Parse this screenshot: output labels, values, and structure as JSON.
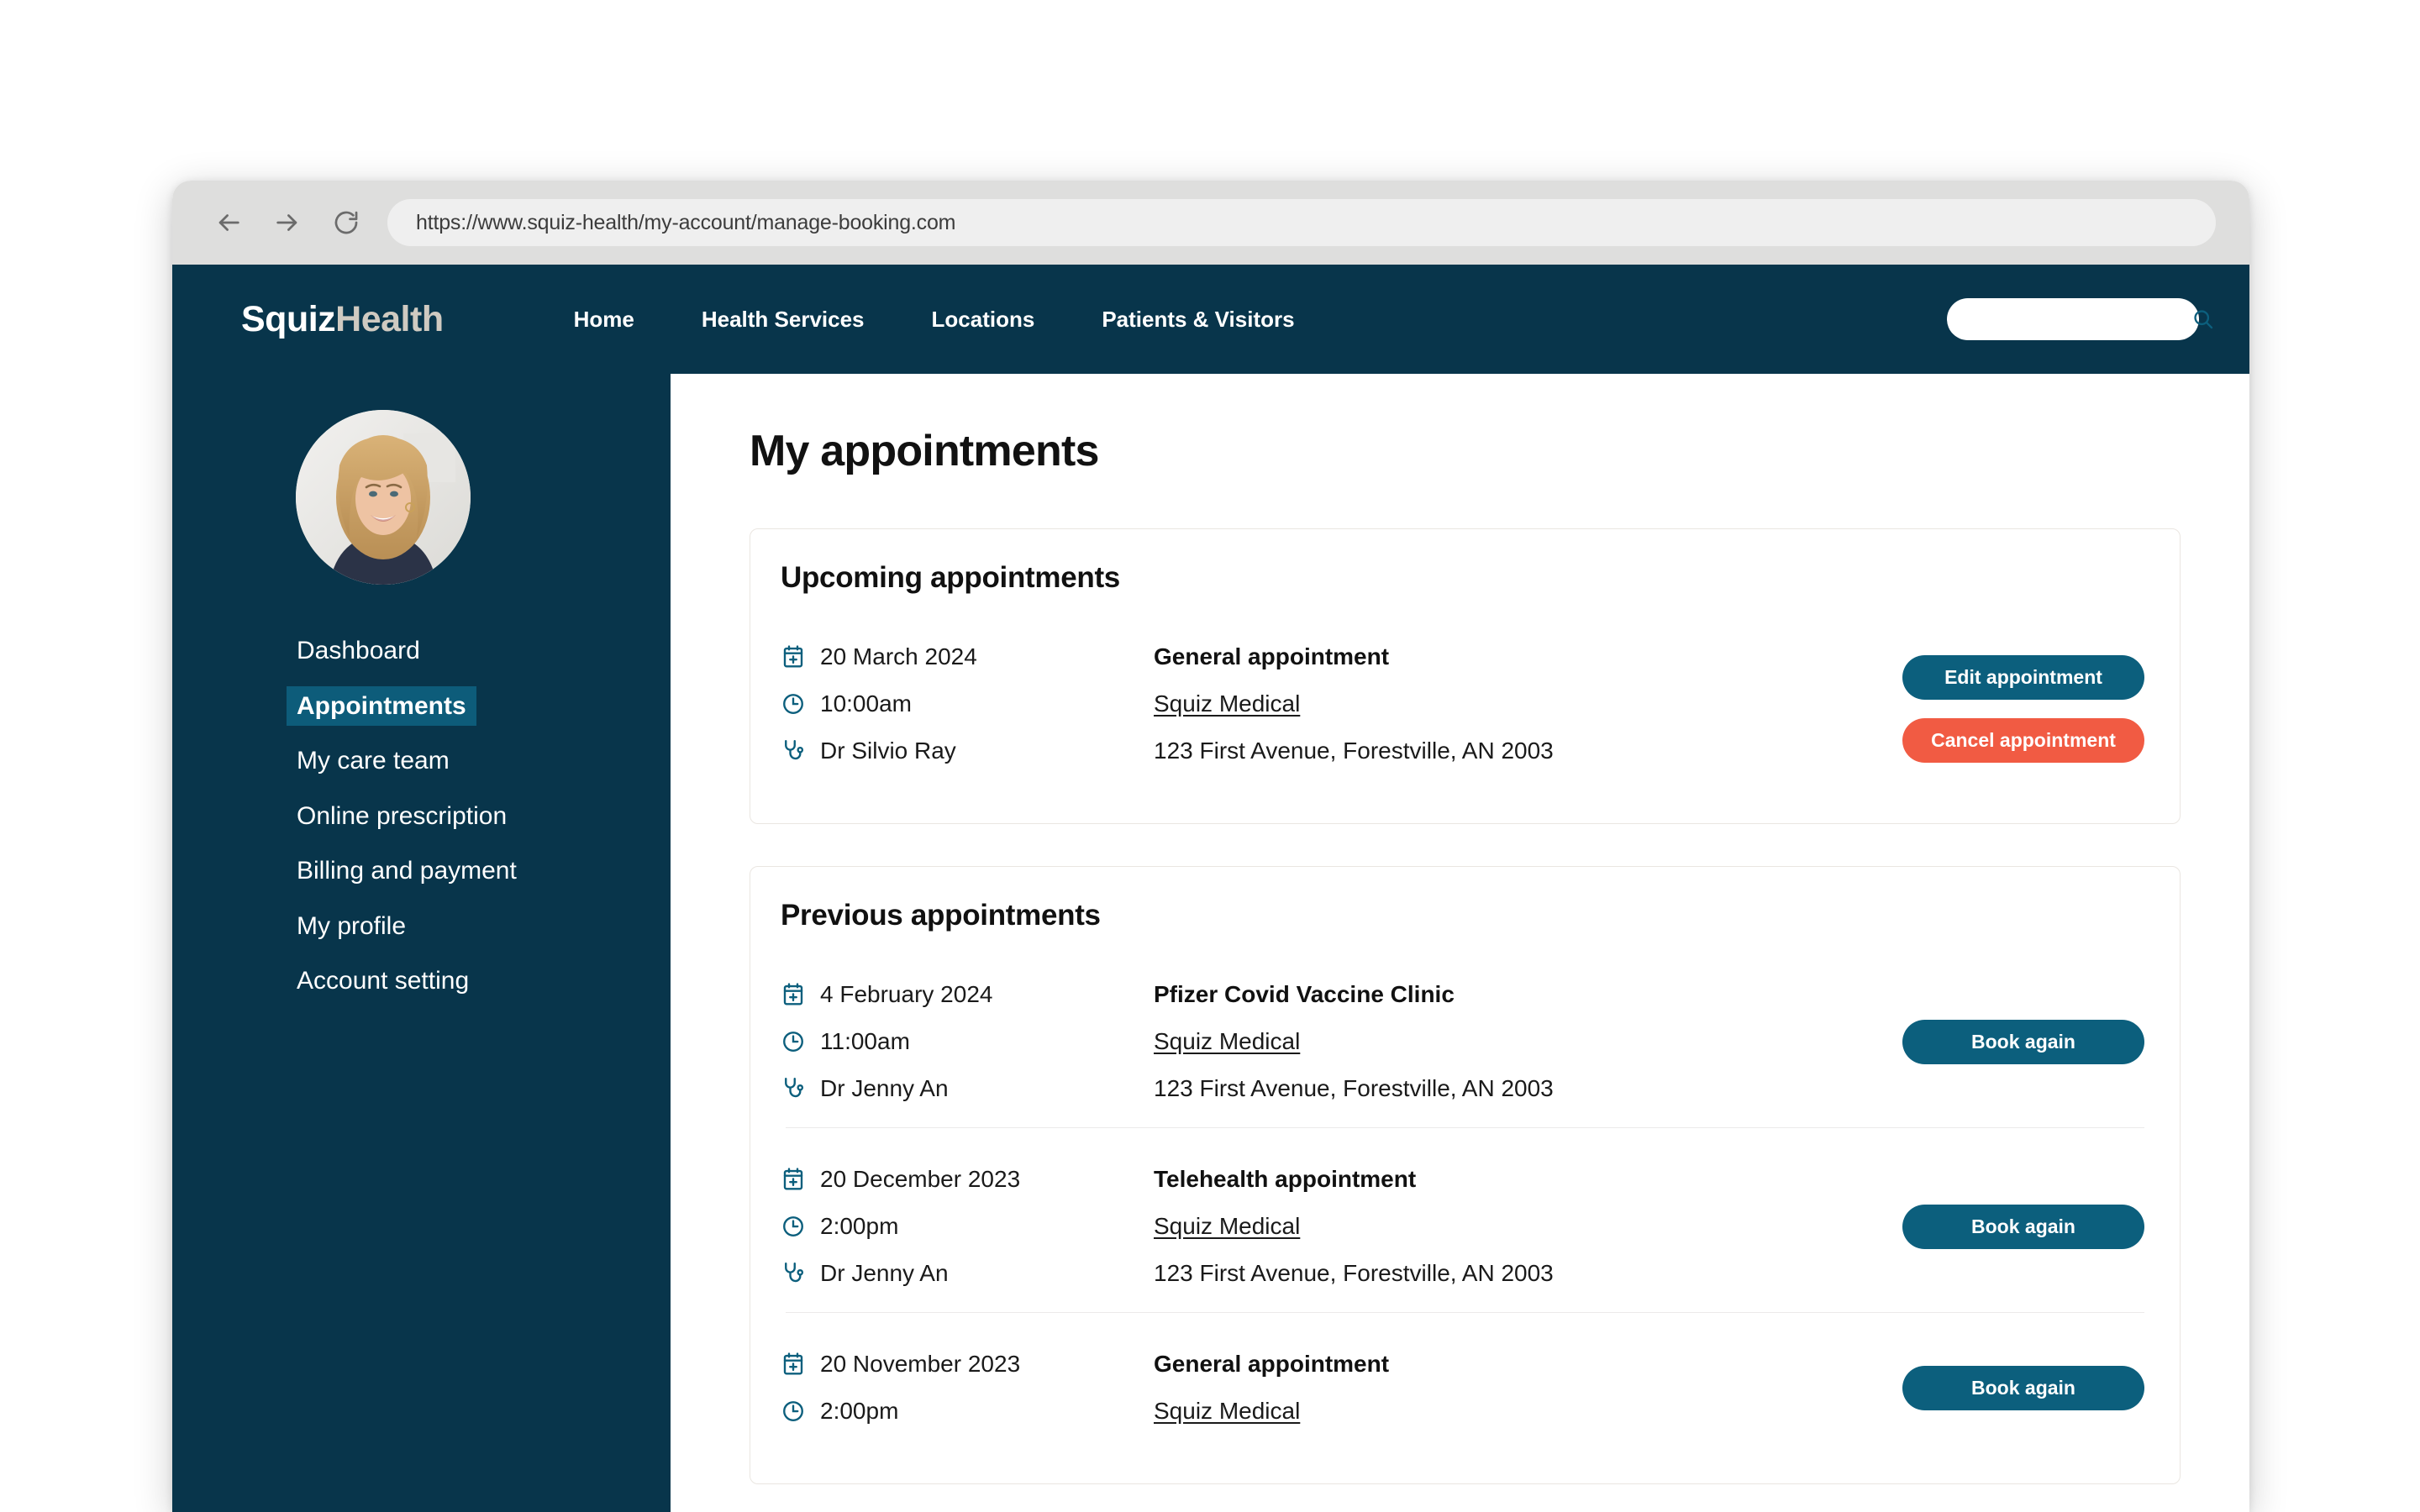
{
  "browser": {
    "back_icon": "arrow-left-icon",
    "forward_icon": "arrow-right-icon",
    "reload_icon": "reload-icon",
    "url": "https://www.squiz-health/my-account/manage-booking.com"
  },
  "site_header": {
    "logo_primary": "Squiz",
    "logo_secondary": "Health",
    "nav": [
      {
        "label": "Home"
      },
      {
        "label": "Health Services"
      },
      {
        "label": "Locations"
      },
      {
        "label": "Patients & Visitors"
      }
    ],
    "search": {
      "value": "",
      "placeholder": "",
      "icon": "search-icon"
    }
  },
  "sidebar": {
    "avatar_alt": "user-avatar",
    "items": [
      {
        "label": "Dashboard",
        "active": false
      },
      {
        "label": "Appointments",
        "active": true
      },
      {
        "label": "My care team",
        "active": false
      },
      {
        "label": "Online prescription",
        "active": false
      },
      {
        "label": "Billing and payment",
        "active": false
      },
      {
        "label": "My profile",
        "active": false
      },
      {
        "label": "Account setting",
        "active": false
      }
    ]
  },
  "main": {
    "page_title": "My appointments",
    "upcoming": {
      "title": "Upcoming appointments",
      "appointments": [
        {
          "date": "20 March 2024",
          "time": "10:00am",
          "doctor": "Dr Silvio Ray",
          "type": "General appointment",
          "provider": "Squiz Medical",
          "address": "123 First Avenue, Forestville, AN 2003",
          "primary_action": "Edit appointment",
          "danger_action": "Cancel appointment"
        }
      ]
    },
    "previous": {
      "title": "Previous appointments",
      "appointments": [
        {
          "date": "4 February 2024",
          "time": "11:00am",
          "doctor": "Dr Jenny An",
          "type": "Pfizer Covid Vaccine Clinic",
          "provider": "Squiz Medical",
          "address": "123 First Avenue, Forestville, AN 2003",
          "primary_action": "Book again"
        },
        {
          "date": "20 December 2023",
          "time": "2:00pm",
          "doctor": "Dr Jenny An",
          "type": "Telehealth appointment",
          "provider": "Squiz Medical",
          "address": "123 First Avenue, Forestville, AN 2003",
          "primary_action": "Book again"
        },
        {
          "date": "20 November 2023",
          "time": "2:00pm",
          "doctor": "",
          "type": "General appointment",
          "provider": "Squiz Medical",
          "address": "",
          "primary_action": "Book again"
        }
      ]
    }
  },
  "icons": {
    "calendar": "calendar-plus-icon",
    "clock": "clock-icon",
    "doctor": "stethoscope-icon"
  },
  "colors": {
    "header_bg": "#08354b",
    "accent_teal": "#0c5f7d",
    "active_nav_bg": "#0d5c7a",
    "danger": "#f15b43",
    "logo_secondary": "#cfcac1"
  }
}
